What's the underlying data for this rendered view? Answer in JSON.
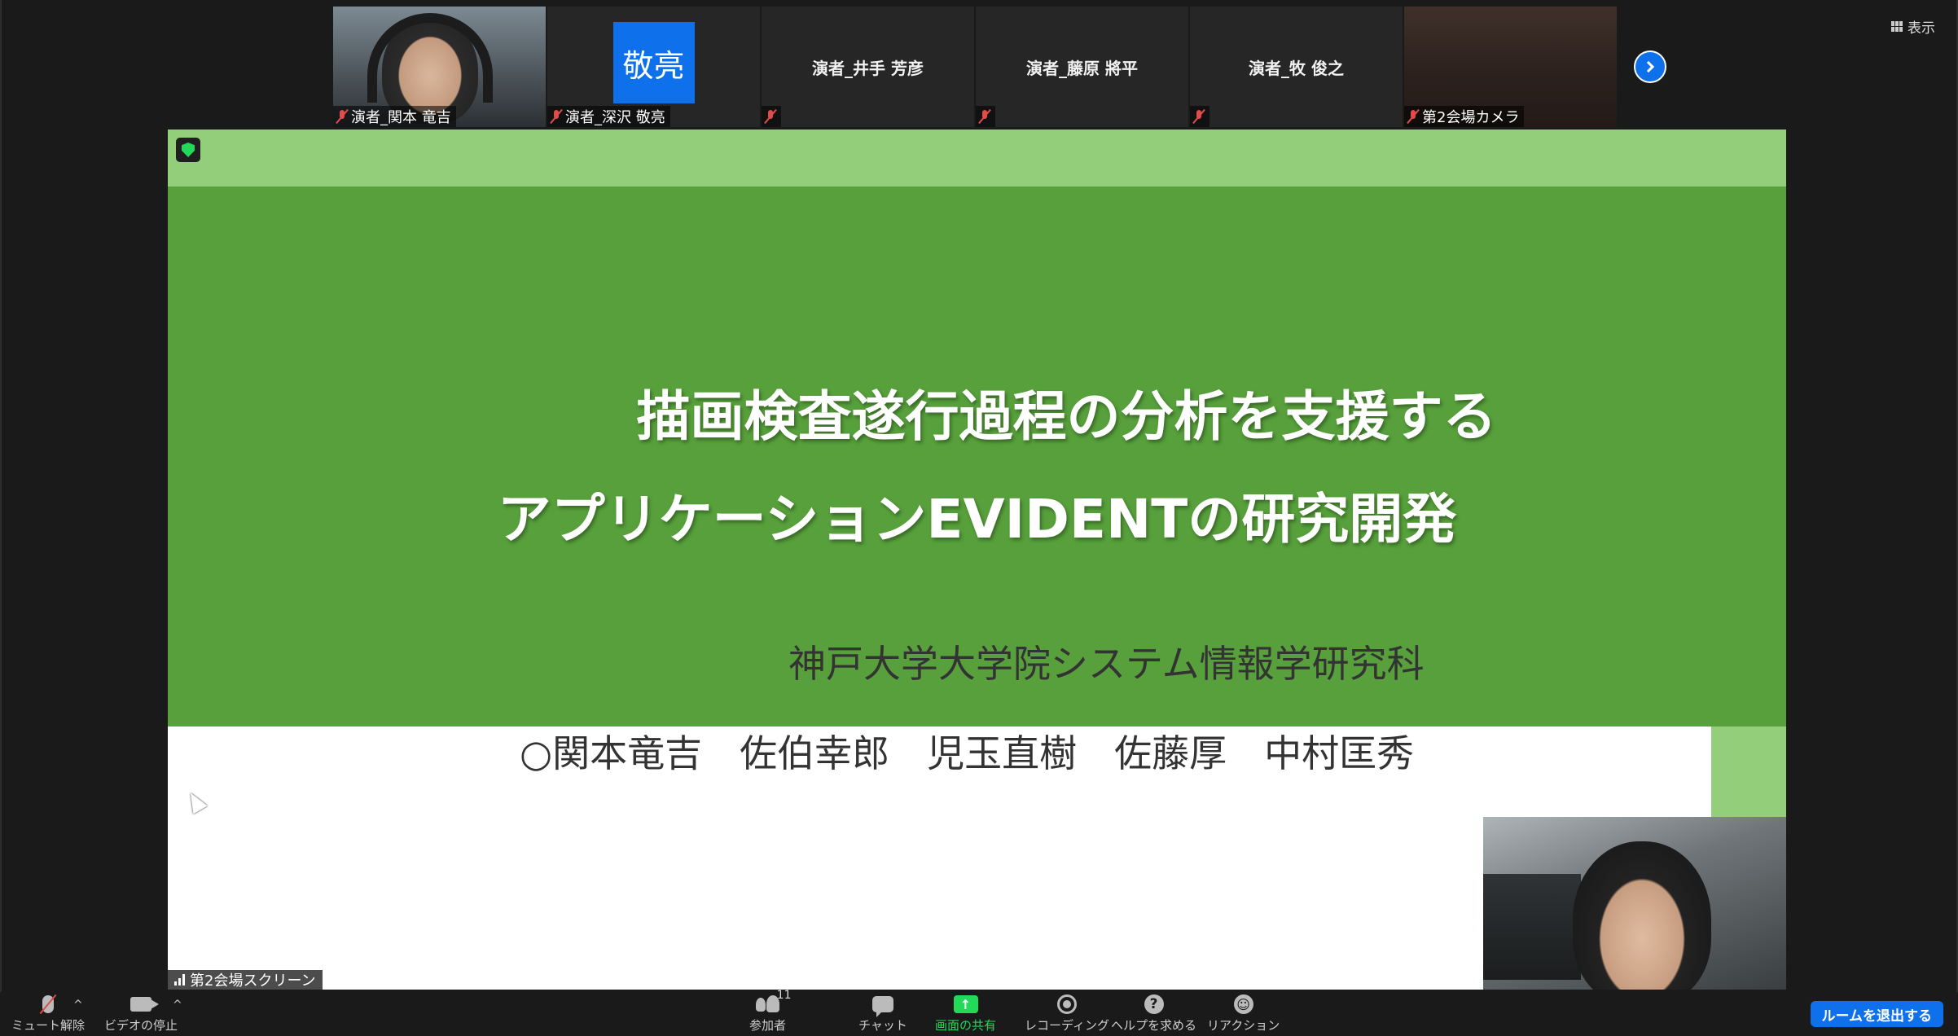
{
  "view_button": {
    "label": "表示"
  },
  "participants": [
    {
      "name": "演者_関本 竜吉",
      "type": "video"
    },
    {
      "name": "演者_深沢 敬亮",
      "type": "avatar",
      "avatar_text": "敬亮"
    },
    {
      "name": "演者_井手 芳彦",
      "type": "name",
      "display": "演者_井手 芳彦"
    },
    {
      "name": "演者_藤原 將平",
      "type": "name",
      "display": "演者_藤原 將平"
    },
    {
      "name": "演者_牧 俊之",
      "type": "name",
      "display": "演者_牧 俊之"
    },
    {
      "name": "第2会場カメラ",
      "type": "video"
    }
  ],
  "shared_screen": {
    "label": "第2会場スクリーン",
    "slide": {
      "title_line1": "描画検査遂行過程の分析を支援する",
      "title_line2": "アプリケーションEVIDENTの研究開発",
      "affiliation": "神戸大学大学院システム情報学研究科",
      "authors": "○関本竜吉　佐伯幸郎　児玉直樹　佐藤厚　中村匡秀"
    }
  },
  "toolbar": {
    "unmute": "ミュート解除",
    "stop_video": "ビデオの停止",
    "participants": "参加者",
    "participant_count": "11",
    "chat": "チャット",
    "share_screen": "画面の共有",
    "recording": "レコーディング",
    "help": "ヘルプを求める",
    "reactions": "リアクション",
    "leave_room": "ルームを退出する"
  },
  "colors": {
    "slide_dark_green": "#57a03b",
    "slide_light_green": "#93cf7a",
    "accent_blue": "#0e71eb",
    "share_green": "#23d959",
    "mute_red": "#e04b4b"
  }
}
